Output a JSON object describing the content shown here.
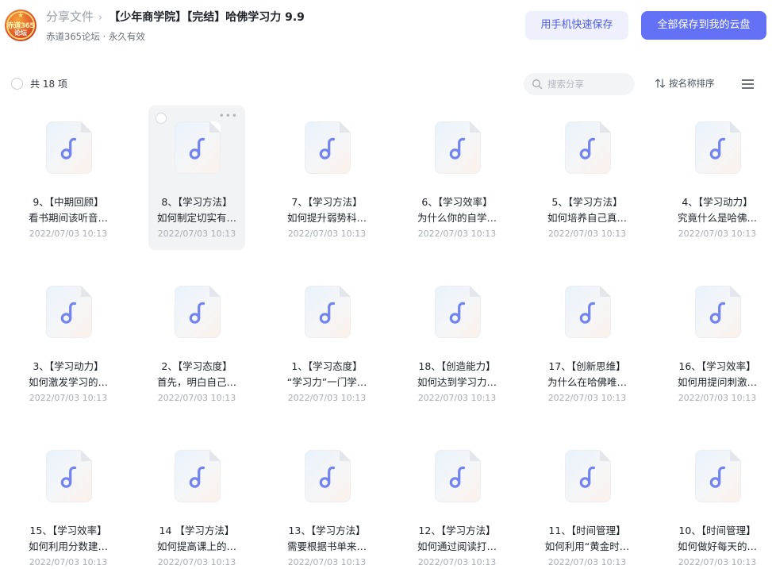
{
  "header": {
    "avatar_text_line1": "赤道365",
    "avatar_text_line2": "论坛",
    "breadcrumb_root": "分享文件",
    "breadcrumb_separator": "›",
    "title": "【少年商学院】【完结】哈佛学习力 9.9",
    "subtitle": "赤道365论坛 · 永久有效",
    "save_phone_label": "用手机快速保存",
    "save_all_label": "全部保存到我的云盘"
  },
  "toolbar": {
    "count_label": "共 18 项",
    "search_placeholder": "搜索分享",
    "sort_label": "按名称排序",
    "menu_icon": "hamburger-menu-icon"
  },
  "colors": {
    "accent": "#6271f5",
    "accent_light": "#eef0fe",
    "audio_icon": "#7383f0"
  },
  "files": [
    {
      "line1": "9、【中期回顾】",
      "line2": "看书期间该听音…",
      "date": "2022/07/03 10:13",
      "icon": "audio-file-icon",
      "hovered": false
    },
    {
      "line1": "8、【学习方法】",
      "line2": "如何制定切实有…",
      "date": "2022/07/03 10:13",
      "icon": "audio-file-icon",
      "hovered": true
    },
    {
      "line1": "7、【学习方法】",
      "line2": "如何提升弱势科…",
      "date": "2022/07/03 10:13",
      "icon": "audio-file-icon",
      "hovered": false
    },
    {
      "line1": "6、【学习效率】",
      "line2": "为什么你的自学…",
      "date": "2022/07/03 10:13",
      "icon": "audio-file-icon",
      "hovered": false
    },
    {
      "line1": "5、【学习方法】",
      "line2": "如何培养自己真…",
      "date": "2022/07/03 10:13",
      "icon": "audio-file-icon",
      "hovered": false
    },
    {
      "line1": "4、【学习动力】",
      "line2": "究竟什么是哈佛…",
      "date": "2022/07/03 10:13",
      "icon": "audio-file-icon",
      "hovered": false
    },
    {
      "line1": "3、【学习动力】",
      "line2": "如何激发学习的…",
      "date": "2022/07/03 10:13",
      "icon": "audio-file-icon",
      "hovered": false
    },
    {
      "line1": "2、【学习态度】",
      "line2": "首先，明白自己…",
      "date": "2022/07/03 10:13",
      "icon": "audio-file-icon",
      "hovered": false
    },
    {
      "line1": "1、【学习态度】",
      "line2": "“学习力”一门学…",
      "date": "2022/07/03 10:13",
      "icon": "audio-file-icon",
      "hovered": false
    },
    {
      "line1": "18、【创造能力】",
      "line2": "如何达到学习力…",
      "date": "2022/07/03 10:13",
      "icon": "audio-file-icon",
      "hovered": false
    },
    {
      "line1": "17、【创新思维】",
      "line2": "为什么在哈佛唯…",
      "date": "2022/07/03 10:13",
      "icon": "audio-file-icon",
      "hovered": false
    },
    {
      "line1": "16、【学习效率】",
      "line2": "如何用提问刺激…",
      "date": "2022/07/03 10:13",
      "icon": "audio-file-icon",
      "hovered": false
    },
    {
      "line1": "15、【学习效率】",
      "line2": "如何利用分数建…",
      "date": "2022/07/03 10:13",
      "icon": "audio-file-icon",
      "hovered": false
    },
    {
      "line1": "14 【学习方法】",
      "line2": "如何提高课上的…",
      "date": "2022/07/03 10:13",
      "icon": "audio-file-icon",
      "hovered": false
    },
    {
      "line1": "13、【学习方法】",
      "line2": "需要根据书单来…",
      "date": "2022/07/03 10:13",
      "icon": "audio-file-icon",
      "hovered": false
    },
    {
      "line1": "12、【学习方法】",
      "line2": "如何通过阅读打…",
      "date": "2022/07/03 10:13",
      "icon": "audio-file-icon",
      "hovered": false
    },
    {
      "line1": "11、【时间管理】",
      "line2": "如何利用“黄金时…",
      "date": "2022/07/03 10:13",
      "icon": "audio-file-icon",
      "hovered": false
    },
    {
      "line1": "10、【时间管理】",
      "line2": "如何做好每天的…",
      "date": "2022/07/03 10:13",
      "icon": "audio-file-icon",
      "hovered": false
    }
  ]
}
